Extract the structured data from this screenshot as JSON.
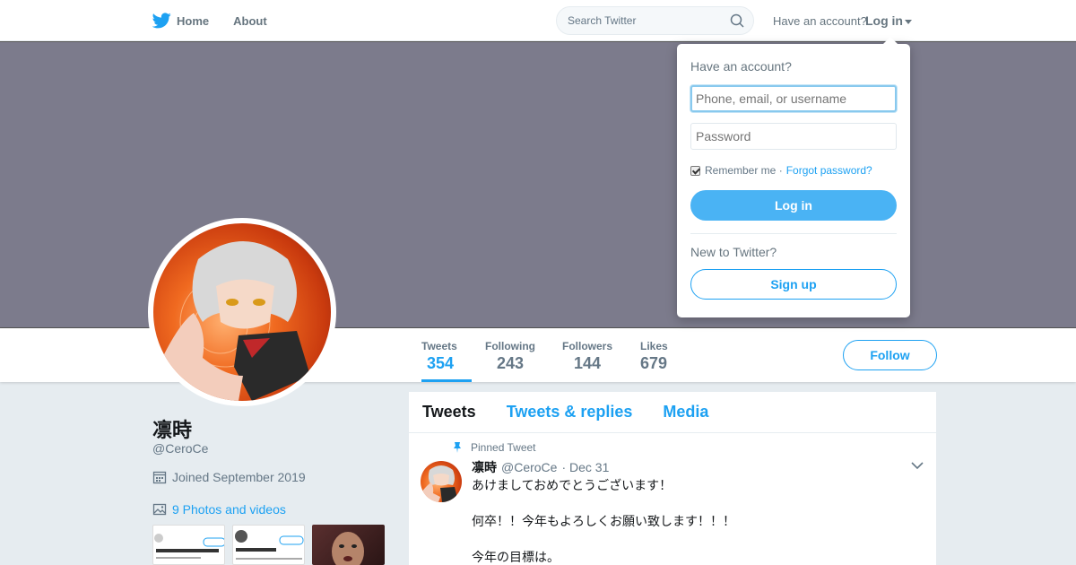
{
  "nav": {
    "home_label": "Home",
    "about_label": "About",
    "search_placeholder": "Search Twitter",
    "have_account": "Have an account?",
    "login_label": "Log in"
  },
  "profile": {
    "name": "凛時",
    "handle": "@CeroCe",
    "joined": "Joined September 2019",
    "photos_label": "9 Photos and videos"
  },
  "stats": [
    {
      "label": "Tweets",
      "value": "354"
    },
    {
      "label": "Following",
      "value": "243"
    },
    {
      "label": "Followers",
      "value": "144"
    },
    {
      "label": "Likes",
      "value": "679"
    }
  ],
  "follow_label": "Follow",
  "timeline": {
    "tabs": [
      "Tweets",
      "Tweets & replies",
      "Media"
    ],
    "pinned_label": "Pinned Tweet",
    "tweet": {
      "name": "凛時",
      "handle": "@CeroCe",
      "date": "· Dec 31",
      "text": "あけましておめでとうございます！\n\n何卒！！今年もよろしくお願い致します！！！\n\n今年の目標は。"
    }
  },
  "login_dropdown": {
    "title": "Have an account?",
    "username_placeholder": "Phone, email, or username",
    "password_placeholder": "Password",
    "remember_label": "Remember me ·",
    "forgot_label": "Forgot password?",
    "login_button": "Log in",
    "new_label": "New to Twitter?",
    "signup_button": "Sign up"
  },
  "colors": {
    "accent": "#1da1f2",
    "banner": "#7c7b8c",
    "background": "#e6ecf0"
  }
}
